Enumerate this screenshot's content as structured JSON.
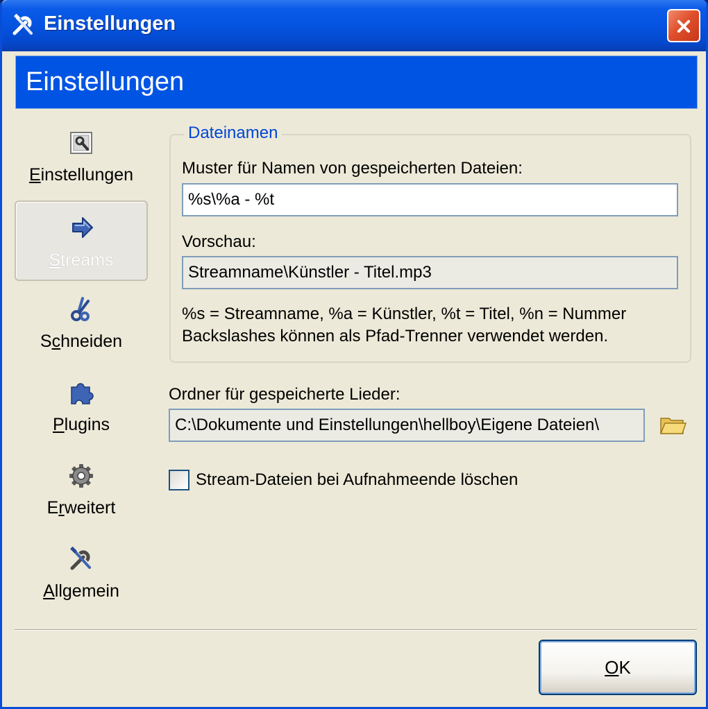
{
  "window": {
    "title": "Einstellungen",
    "title_icon": "wrench-screwdriver-icon",
    "close_icon": "close-icon"
  },
  "banner": {
    "title": "Einstellungen"
  },
  "nav": {
    "items": [
      {
        "label_access": "E",
        "label_rest": "instellungen",
        "icon": "settings-icon",
        "selected": false
      },
      {
        "label_access": "S",
        "label_rest": "treams",
        "icon": "arrow-right-icon",
        "selected": true
      },
      {
        "label_pre": "S",
        "label_access": "c",
        "label_rest": "hneiden",
        "icon": "scissors-icon",
        "selected": false
      },
      {
        "label_access": "P",
        "label_rest": "lugins",
        "icon": "puzzle-piece-icon",
        "selected": false
      },
      {
        "label_pre": "E",
        "label_access": "r",
        "label_rest": "weitert",
        "icon": "gear-icon",
        "selected": false
      },
      {
        "label_access": "A",
        "label_rest": "llgemein",
        "icon": "wrench-screwdriver-icon",
        "selected": false
      }
    ]
  },
  "dateinamen": {
    "legend": "Dateinamen",
    "pattern_label": "Muster für Namen von gespeicherten Dateien:",
    "pattern_value": "%s\\%a - %t",
    "preview_label": "Vorschau:",
    "preview_value": "Streamname\\Künstler - Titel.mp3",
    "help_line1": "%s = Streamname, %a = Künstler, %t = Titel, %n = Nummer",
    "help_line2": "Backslashes können als Pfad-Trenner verwendet werden."
  },
  "folder": {
    "label": "Ordner für gespeicherte Lieder:",
    "value": "C:\\Dokumente und Einstellungen\\hellboy\\Eigene Dateien\\",
    "browse_icon": "folder-icon"
  },
  "delete_option": {
    "label": "Stream-Dateien bei Aufnahmeende löschen",
    "checked": false
  },
  "buttons": {
    "ok_access": "O",
    "ok_rest": "K"
  },
  "colors": {
    "titlebar": "#0553E0",
    "banner": "#0054E3",
    "dialog_bg": "#ECE9D8",
    "legend_text": "#0046D5",
    "close_button": "#E0502C"
  }
}
